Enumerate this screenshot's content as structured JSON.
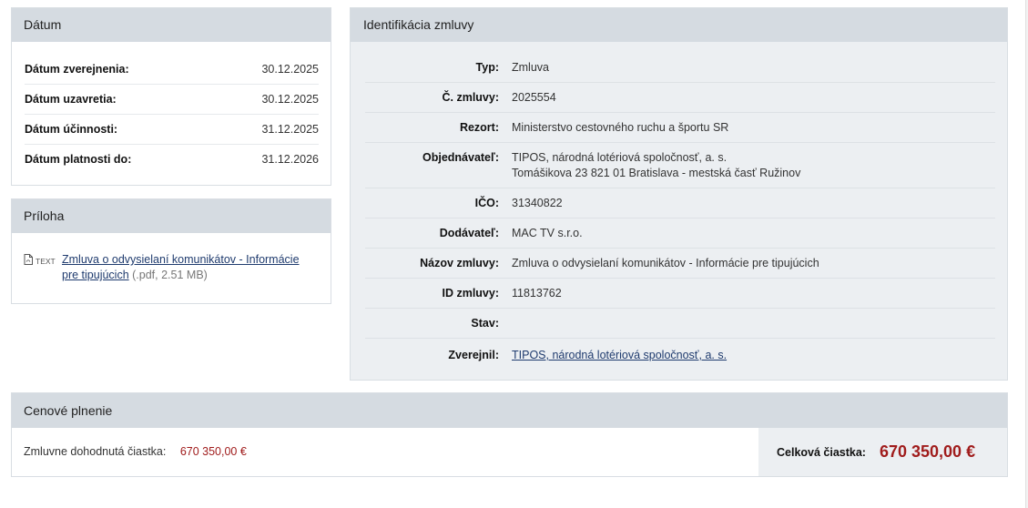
{
  "datum": {
    "title": "Dátum",
    "rows": [
      {
        "label": "Dátum zverejnenia:",
        "value": "30.12.2025"
      },
      {
        "label": "Dátum uzavretia:",
        "value": "30.12.2025"
      },
      {
        "label": "Dátum účinnosti:",
        "value": "31.12.2025"
      },
      {
        "label": "Dátum platnosti do:",
        "value": "31.12.2026"
      }
    ]
  },
  "priloha": {
    "title": "Príloha",
    "icon": "pdf-file-icon",
    "icon_text": "TEXT",
    "link_text": "Zmluva o odvysielaní komunikátov - Informácie pre tipujúcich",
    "meta": "(.pdf, 2.51 MB)"
  },
  "identifikacia": {
    "title": "Identifikácia zmluvy",
    "typ_label": "Typ:",
    "typ": "Zmluva",
    "cislo_label": "Č. zmluvy:",
    "cislo": "2025554",
    "rezort_label": "Rezort:",
    "rezort": "Ministerstvo cestovného ruchu a športu SR",
    "objednavatel_label": "Objednávateľ:",
    "objednavatel_line1": "TIPOS, národná lotériová spoločnosť, a. s.",
    "objednavatel_line2": "Tomášikova 23 821 01 Bratislava - mestská časť Ružinov",
    "ico_label": "IČO:",
    "ico": "31340822",
    "dodavatel_label": "Dodávateľ:",
    "dodavatel": "MAC TV s.r.o.",
    "nazov_label": "Názov zmluvy:",
    "nazov": "Zmluva o odvysielaní komunikátov - Informácie pre tipujúcich",
    "id_label": "ID zmluvy:",
    "id": "11813762",
    "stav_label": "Stav:",
    "stav": "",
    "zverejnil_label": "Zverejnil:",
    "zverejnil": "TIPOS, národná lotériová spoločnosť, a. s."
  },
  "cena": {
    "title": "Cenové plnenie",
    "dohodnuta_label": "Zmluvne dohodnutá čiastka:",
    "dohodnuta": "670 350,00 €",
    "celkova_label": "Celková čiastka:",
    "celkova": "670 350,00 €",
    "accent_color": "#a01c1c"
  }
}
